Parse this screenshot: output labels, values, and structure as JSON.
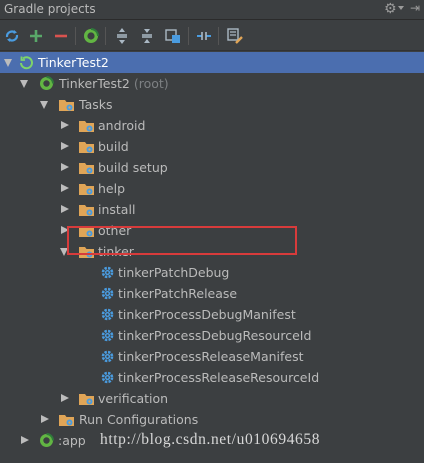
{
  "panel": {
    "title": "Gradle projects"
  },
  "toolbar": {
    "buttons": [
      "refresh-icon",
      "add-icon",
      "remove-icon",
      "gradle-task-icon",
      "expand-all-icon",
      "collapse-all-icon",
      "attach-icon",
      "toggle-offline-icon",
      "settings-icon"
    ]
  },
  "tree": {
    "root": {
      "label": "TinkerTest2"
    },
    "project": {
      "label": "TinkerTest2",
      "suffix": "(root)"
    },
    "tasks": {
      "label": "Tasks"
    },
    "groups": [
      "android",
      "build",
      "build setup",
      "help",
      "install",
      "other",
      "tinker"
    ],
    "tinker_tasks": [
      "tinkerPatchDebug",
      "tinkerPatchRelease",
      "tinkerProcessDebugManifest",
      "tinkerProcessDebugResourceId",
      "tinkerProcessReleaseManifest",
      "tinkerProcessReleaseResourceId"
    ],
    "verification": {
      "label": "verification"
    },
    "run_configurations": {
      "label": "Run Configurations"
    },
    "app": {
      "label": ":app"
    }
  },
  "highlighted_task": "tinkerPatchRelease",
  "watermark": "http://blog.csdn.net/u010694658",
  "colors": {
    "background": "#3c3f41",
    "selection": "#4b6eaf",
    "highlight_border": "#d83b3b",
    "gradle_green": "#62b543",
    "folder": "#e0a557"
  }
}
